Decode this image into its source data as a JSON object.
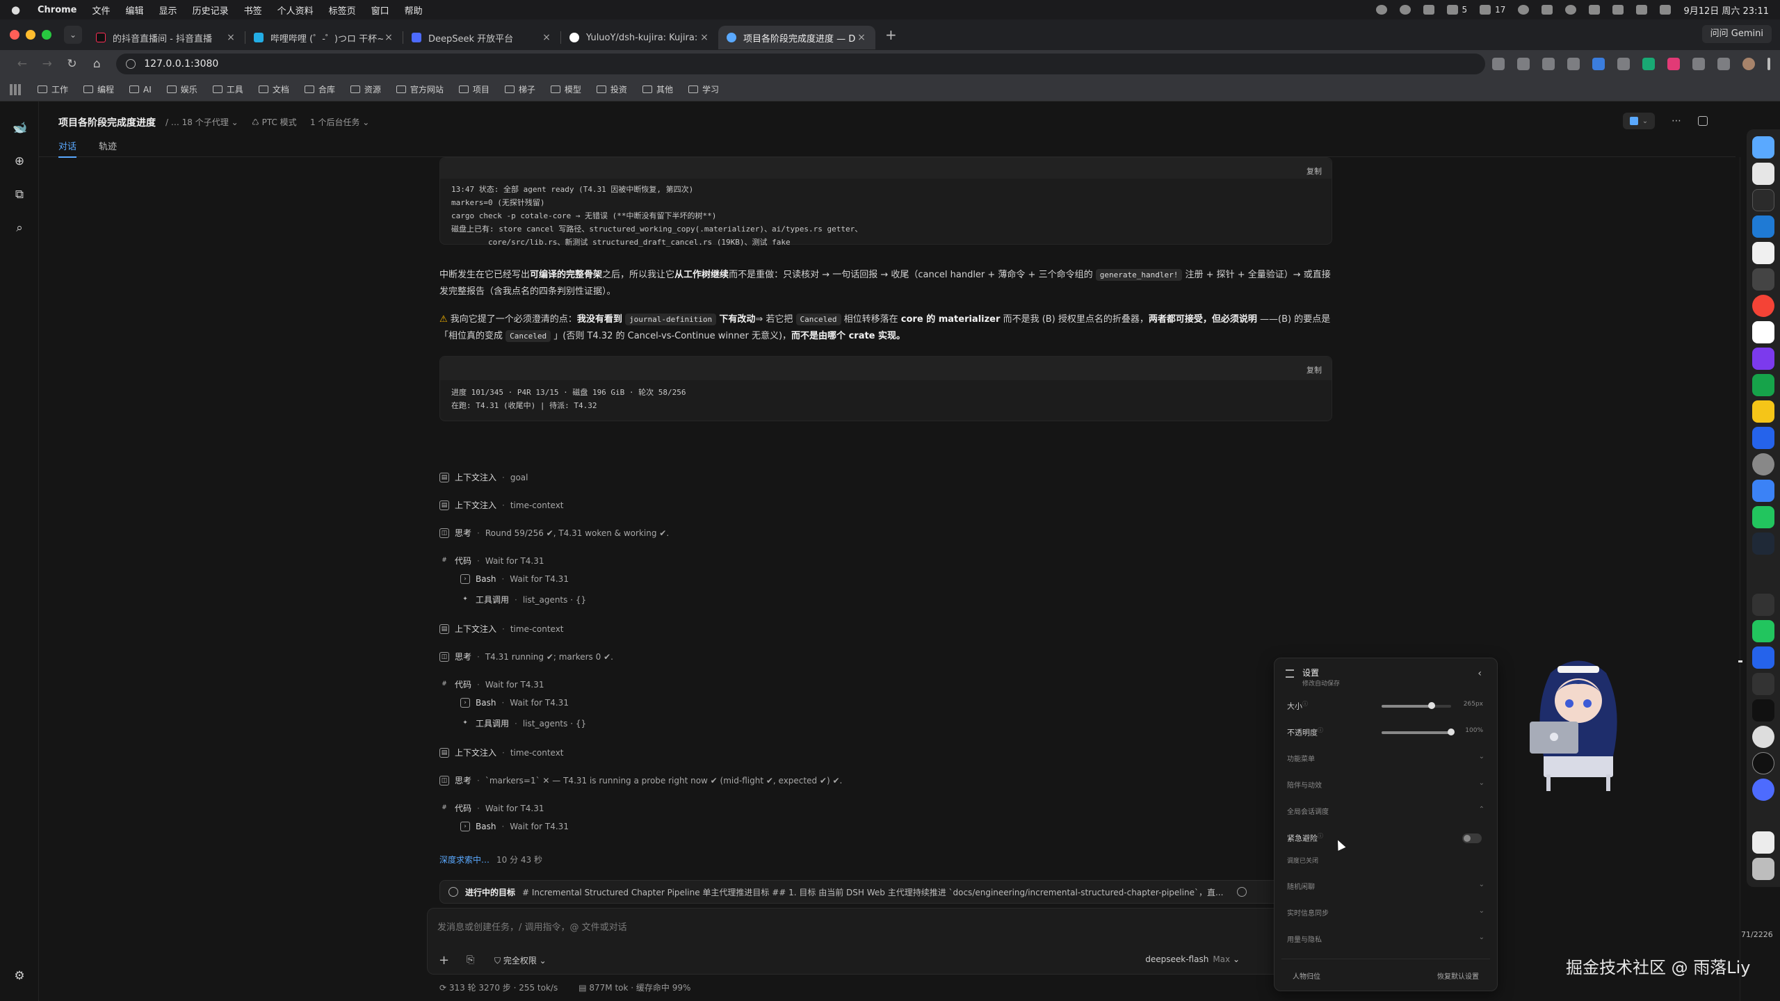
{
  "menubar": {
    "app": "Chrome",
    "items": [
      "文件",
      "编辑",
      "显示",
      "历史记录",
      "书签",
      "个人资料",
      "标签页",
      "窗口",
      "帮助"
    ],
    "badge1": "5",
    "badge2": "17",
    "datetime": "9月12日 周六 23:11"
  },
  "browser": {
    "tabs": [
      {
        "title": "的抖音直播间 - 抖音直播",
        "fav": "#111111"
      },
      {
        "title": "哔哩哔哩 (゜-゜)つロ 干杯~-bilibili",
        "fav": "#23ade5"
      },
      {
        "title": "DeepSeek 开放平台",
        "fav": "#4d6bfe"
      },
      {
        "title": "YuluoY/dsh-kujira: Kujira: an agent",
        "fav": "#ffffff"
      },
      {
        "title": "项目各阶段完成度进度 — DeepSeek",
        "fav": "#5aa9ff"
      }
    ],
    "new_tab": "+",
    "gemini": "问问 Gemini",
    "url": "127.0.0.1:3080",
    "bookmarks": [
      "工作",
      "编程",
      "AI",
      "娱乐",
      "工具",
      "文档",
      "合库",
      "资源",
      "官方网站",
      "项目",
      "梯子",
      "模型",
      "投资",
      "其他",
      "学习"
    ]
  },
  "header": {
    "title": "项目各阶段完成度进度",
    "subagents": "18 个子代理",
    "mode": "PTC 模式",
    "bgtasks": "1 个后台任务",
    "tabs": [
      "对话",
      "轨迹"
    ]
  },
  "content": {
    "code1": {
      "copy": "复制",
      "lines": [
        "13:47 状态: 全部 agent ready (T4.31 因被中断恢复, 第四次)",
        "markers=0 (无探针残留)",
        "cargo check -p cotale-core → 无错误 (**中断没有留下半坏的树**)",
        "磁盘上已有: store cancel 写路径、structured_working_copy(.materializer)、ai/types.rs getter、",
        "        core/src/lib.rs、新测试 structured_draft_cancel.rs (19KB)、测试 fake"
      ]
    },
    "p1": {
      "a": "中断发生在它已经写出",
      "b": "可编译的完整骨架",
      "c": "之后，所以我让它",
      "d": "从工作树继续",
      "e": "而不是重做：只读核对 → 一句话回报 → 收尾（cancel handler + 薄命令 + 三个命令组的",
      "code": "generate_handler!",
      "f": "注册 + 探针 + 全量验证）→ 或直接发完整报告（含我点名的四条判别性证据）。"
    },
    "p2": {
      "a": "我向它提了一个必须澄清的点：",
      "b": "我没有看到",
      "code1": "journal-definition",
      "c": "下有改动",
      "d": "⇒ 若它把",
      "code2": "Canceled",
      "e": "相位转移落在",
      "f": "core 的 materializer",
      "g": "而不是我 (B) 授权里点名的折叠器，",
      "h": "两者都可接受，但必须说明",
      "i": "——(B) 的要点是「相位真的变成",
      "code3": "Canceled",
      "j": "」(否则 T4.32 的 Cancel-vs-Continue winner 无意义)，",
      "k": "而不是由哪个 crate 实现。"
    },
    "code2": {
      "copy": "复制",
      "lines": [
        "进度 101/345 · P4R 13/15 · 磁盘 196 GiB · 轮次 58/256",
        "在跑: T4.31 (收尾中) | 待派: T4.32"
      ]
    },
    "trace": [
      {
        "lbl": "上下文注入",
        "det": "goal"
      },
      {
        "lbl": "上下文注入",
        "det": "time-context"
      },
      {
        "lbl": "思考",
        "det": "Round 59/256 ✔, T4.31 woken & working ✔."
      },
      {
        "lbl": "代码",
        "det": "Wait for T4.31"
      },
      {
        "lbl": "Bash",
        "det": "Wait for T4.31"
      },
      {
        "lbl": "工具调用",
        "det": "list_agents · {}"
      },
      {
        "lbl": "上下文注入",
        "det": "time-context"
      },
      {
        "lbl": "思考",
        "det": "T4.31 running ✔; markers 0 ✔."
      },
      {
        "lbl": "代码",
        "det": "Wait for T4.31"
      },
      {
        "lbl": "Bash",
        "det": "Wait for T4.31"
      },
      {
        "lbl": "工具调用",
        "det": "list_agents · {}"
      },
      {
        "lbl": "上下文注入",
        "det": "time-context"
      },
      {
        "lbl": "思考",
        "det": "`markers=1` ✕ — T4.31 is running a probe right now ✔ (mid-flight ✔, expected ✔) ✔."
      },
      {
        "lbl": "代码",
        "det": "Wait for T4.31"
      },
      {
        "lbl": "Bash",
        "det": "Wait for T4.31"
      }
    ],
    "deep_label": "深度求索中…",
    "deep_time": "10 分 43 秒"
  },
  "goal": {
    "label": "进行中的目标",
    "text": "# Incremental Structured Chapter Pipeline 单主代理推进目标 ## 1. 目标 由当前 DSH Web 主代理持续推进 `docs/engineering/incremental-structured-chapter-pipeline`，直..."
  },
  "composer": {
    "placeholder": "发消息或创建任务，/ 调用指令，@ 文件或对话",
    "permission": "完全权限",
    "model": "deepseek-flash",
    "effort": "Max"
  },
  "status": {
    "rounds": "313 轮 3270 步 · 255 tok/s",
    "tokens": "877M tok · 缓存命中 99%"
  },
  "settings": {
    "title": "设置",
    "subtitle": "修改自动保存",
    "size_label": "大小",
    "size_value": "265px",
    "size_level": 0.72,
    "opacity_label": "不透明度",
    "opacity_value": "100%",
    "opacity_level": 1.0,
    "sections": [
      "功能菜单",
      "陪伴与动效",
      "全局会话调度"
    ],
    "emergency_label": "紧急避险",
    "emergency_sub": "调度已关闭",
    "more_sections": [
      "随机闲聊",
      "实时信息同步",
      "用量与隐私"
    ],
    "reset_position": "人物归位",
    "restore_defaults": "恢复默认设置"
  },
  "page_counter": "71/2226",
  "watermark": "掘金技术社区 @ 雨落Liy"
}
